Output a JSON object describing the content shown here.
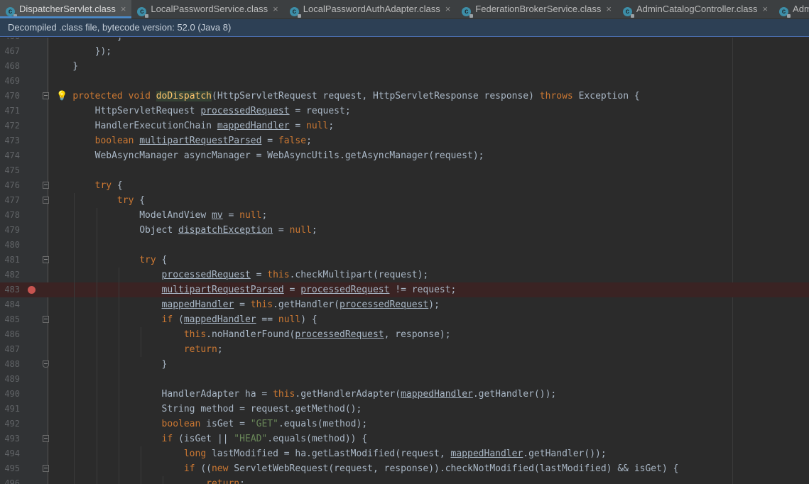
{
  "tabs": [
    {
      "label": "DispatcherServlet.class",
      "active": true
    },
    {
      "label": "LocalPasswordService.class",
      "active": false
    },
    {
      "label": "LocalPasswordAuthAdapter.class",
      "active": false
    },
    {
      "label": "FederationBrokerService.class",
      "active": false
    },
    {
      "label": "AdminCatalogController.class",
      "active": false
    },
    {
      "label": "Admin",
      "active": false
    }
  ],
  "tab_icon_letter": "c",
  "close_glyph": "×",
  "infobar": {
    "text": "Decompiled .class file, bytecode version: 52.0 (Java 8)"
  },
  "colors": {
    "keyword": "#cc7832",
    "string": "#6a8759",
    "method": "#ffc66d",
    "plain": "#a9b7c6",
    "breakpoint": "#c75450",
    "tab_accent": "#4a88c7"
  },
  "editor": {
    "breakpoint_line": "483",
    "intention_bulb_line": "470",
    "lines": [
      {
        "n": "466",
        "ind": 0,
        "t": [
          {
            "s": "            }"
          }
        ]
      },
      {
        "n": "467",
        "ind": 0,
        "t": [
          {
            "s": "        });"
          }
        ]
      },
      {
        "n": "468",
        "ind": 0,
        "t": [
          {
            "s": "    }"
          }
        ]
      },
      {
        "n": "469",
        "ind": 0,
        "t": []
      },
      {
        "n": "470",
        "ind": 0,
        "fold": "start",
        "t": [
          {
            "s": "    "
          },
          {
            "s": "protected",
            "c": "kw"
          },
          {
            "s": " "
          },
          {
            "s": "void",
            "c": "kw"
          },
          {
            "s": " "
          },
          {
            "s": "doDispatch",
            "c": "mth hl"
          },
          {
            "s": "(HttpServletRequest request, HttpServletResponse response) "
          },
          {
            "s": "throws",
            "c": "kw"
          },
          {
            "s": " Exception {"
          }
        ]
      },
      {
        "n": "471",
        "ind": 1,
        "t": [
          {
            "s": "        HttpServletRequest "
          },
          {
            "s": "processedRequest",
            "c": "u"
          },
          {
            "s": " = request;"
          }
        ]
      },
      {
        "n": "472",
        "ind": 1,
        "t": [
          {
            "s": "        HandlerExecutionChain "
          },
          {
            "s": "mappedHandler",
            "c": "u"
          },
          {
            "s": " = "
          },
          {
            "s": "null",
            "c": "kw"
          },
          {
            "s": ";"
          }
        ]
      },
      {
        "n": "473",
        "ind": 1,
        "t": [
          {
            "s": "        "
          },
          {
            "s": "boolean",
            "c": "kw"
          },
          {
            "s": " "
          },
          {
            "s": "multipartRequestParsed",
            "c": "u"
          },
          {
            "s": " = "
          },
          {
            "s": "false",
            "c": "kw"
          },
          {
            "s": ";"
          }
        ]
      },
      {
        "n": "474",
        "ind": 1,
        "t": [
          {
            "s": "        WebAsyncManager asyncManager = WebAsyncUtils.getAsyncManager(request);"
          }
        ]
      },
      {
        "n": "475",
        "ind": 1,
        "t": []
      },
      {
        "n": "476",
        "ind": 1,
        "fold": "start",
        "t": [
          {
            "s": "        "
          },
          {
            "s": "try",
            "c": "kw"
          },
          {
            "s": " {"
          }
        ]
      },
      {
        "n": "477",
        "ind": 2,
        "fold": "start",
        "t": [
          {
            "s": "            "
          },
          {
            "s": "try",
            "c": "kw"
          },
          {
            "s": " {"
          }
        ]
      },
      {
        "n": "478",
        "ind": 3,
        "t": [
          {
            "s": "                ModelAndView "
          },
          {
            "s": "mv",
            "c": "u"
          },
          {
            "s": " = "
          },
          {
            "s": "null",
            "c": "kw"
          },
          {
            "s": ";"
          }
        ]
      },
      {
        "n": "479",
        "ind": 3,
        "t": [
          {
            "s": "                Object "
          },
          {
            "s": "dispatchException",
            "c": "u"
          },
          {
            "s": " = "
          },
          {
            "s": "null",
            "c": "kw"
          },
          {
            "s": ";"
          }
        ]
      },
      {
        "n": "480",
        "ind": 3,
        "t": []
      },
      {
        "n": "481",
        "ind": 3,
        "fold": "start",
        "t": [
          {
            "s": "                "
          },
          {
            "s": "try",
            "c": "kw"
          },
          {
            "s": " {"
          }
        ]
      },
      {
        "n": "482",
        "ind": 4,
        "t": [
          {
            "s": "                    "
          },
          {
            "s": "processedRequest",
            "c": "u"
          },
          {
            "s": " = "
          },
          {
            "s": "this",
            "c": "kw"
          },
          {
            "s": ".checkMultipart(request);"
          }
        ]
      },
      {
        "n": "483",
        "ind": 4,
        "bp": true,
        "t": [
          {
            "s": "                    "
          },
          {
            "s": "multipartRequestParsed",
            "c": "u"
          },
          {
            "s": " = "
          },
          {
            "s": "processedRequest",
            "c": "u"
          },
          {
            "s": " != request;"
          }
        ]
      },
      {
        "n": "484",
        "ind": 4,
        "t": [
          {
            "s": "                    "
          },
          {
            "s": "mappedHandler",
            "c": "u"
          },
          {
            "s": " = "
          },
          {
            "s": "this",
            "c": "kw"
          },
          {
            "s": ".getHandler("
          },
          {
            "s": "processedRequest",
            "c": "u"
          },
          {
            "s": ");"
          }
        ]
      },
      {
        "n": "485",
        "ind": 4,
        "fold": "start",
        "t": [
          {
            "s": "                    "
          },
          {
            "s": "if",
            "c": "kw"
          },
          {
            "s": " ("
          },
          {
            "s": "mappedHandler",
            "c": "u"
          },
          {
            "s": " == "
          },
          {
            "s": "null",
            "c": "kw"
          },
          {
            "s": ") {"
          }
        ]
      },
      {
        "n": "486",
        "ind": 5,
        "t": [
          {
            "s": "                        "
          },
          {
            "s": "this",
            "c": "kw"
          },
          {
            "s": ".noHandlerFound("
          },
          {
            "s": "processedRequest",
            "c": "u"
          },
          {
            "s": ", response);"
          }
        ]
      },
      {
        "n": "487",
        "ind": 5,
        "t": [
          {
            "s": "                        "
          },
          {
            "s": "return",
            "c": "kw"
          },
          {
            "s": ";"
          }
        ]
      },
      {
        "n": "488",
        "ind": 4,
        "fold": "end",
        "t": [
          {
            "s": "                    }"
          }
        ]
      },
      {
        "n": "489",
        "ind": 4,
        "t": []
      },
      {
        "n": "490",
        "ind": 4,
        "t": [
          {
            "s": "                    HandlerAdapter ha = "
          },
          {
            "s": "this",
            "c": "kw"
          },
          {
            "s": ".getHandlerAdapter("
          },
          {
            "s": "mappedHandler",
            "c": "u"
          },
          {
            "s": ".getHandler());"
          }
        ]
      },
      {
        "n": "491",
        "ind": 4,
        "t": [
          {
            "s": "                    String method = request.getMethod();"
          }
        ]
      },
      {
        "n": "492",
        "ind": 4,
        "t": [
          {
            "s": "                    "
          },
          {
            "s": "boolean",
            "c": "kw"
          },
          {
            "s": " isGet = "
          },
          {
            "s": "\"GET\"",
            "c": "str"
          },
          {
            "s": ".equals(method);"
          }
        ]
      },
      {
        "n": "493",
        "ind": 4,
        "fold": "start",
        "t": [
          {
            "s": "                    "
          },
          {
            "s": "if",
            "c": "kw"
          },
          {
            "s": " (isGet || "
          },
          {
            "s": "\"HEAD\"",
            "c": "str"
          },
          {
            "s": ".equals(method)) {"
          }
        ]
      },
      {
        "n": "494",
        "ind": 5,
        "t": [
          {
            "s": "                        "
          },
          {
            "s": "long",
            "c": "kw"
          },
          {
            "s": " lastModified = ha.getLastModified(request, "
          },
          {
            "s": "mappedHandler",
            "c": "u"
          },
          {
            "s": ".getHandler());"
          }
        ]
      },
      {
        "n": "495",
        "ind": 5,
        "fold": "start",
        "t": [
          {
            "s": "                        "
          },
          {
            "s": "if",
            "c": "kw"
          },
          {
            "s": " (("
          },
          {
            "s": "new",
            "c": "kw"
          },
          {
            "s": " ServletWebRequest(request, response)).checkNotModified(lastModified) && isGet) {"
          }
        ]
      },
      {
        "n": "496",
        "ind": 6,
        "t": [
          {
            "s": "                            "
          },
          {
            "s": "return",
            "c": "kw"
          },
          {
            "s": ";"
          }
        ]
      }
    ]
  }
}
